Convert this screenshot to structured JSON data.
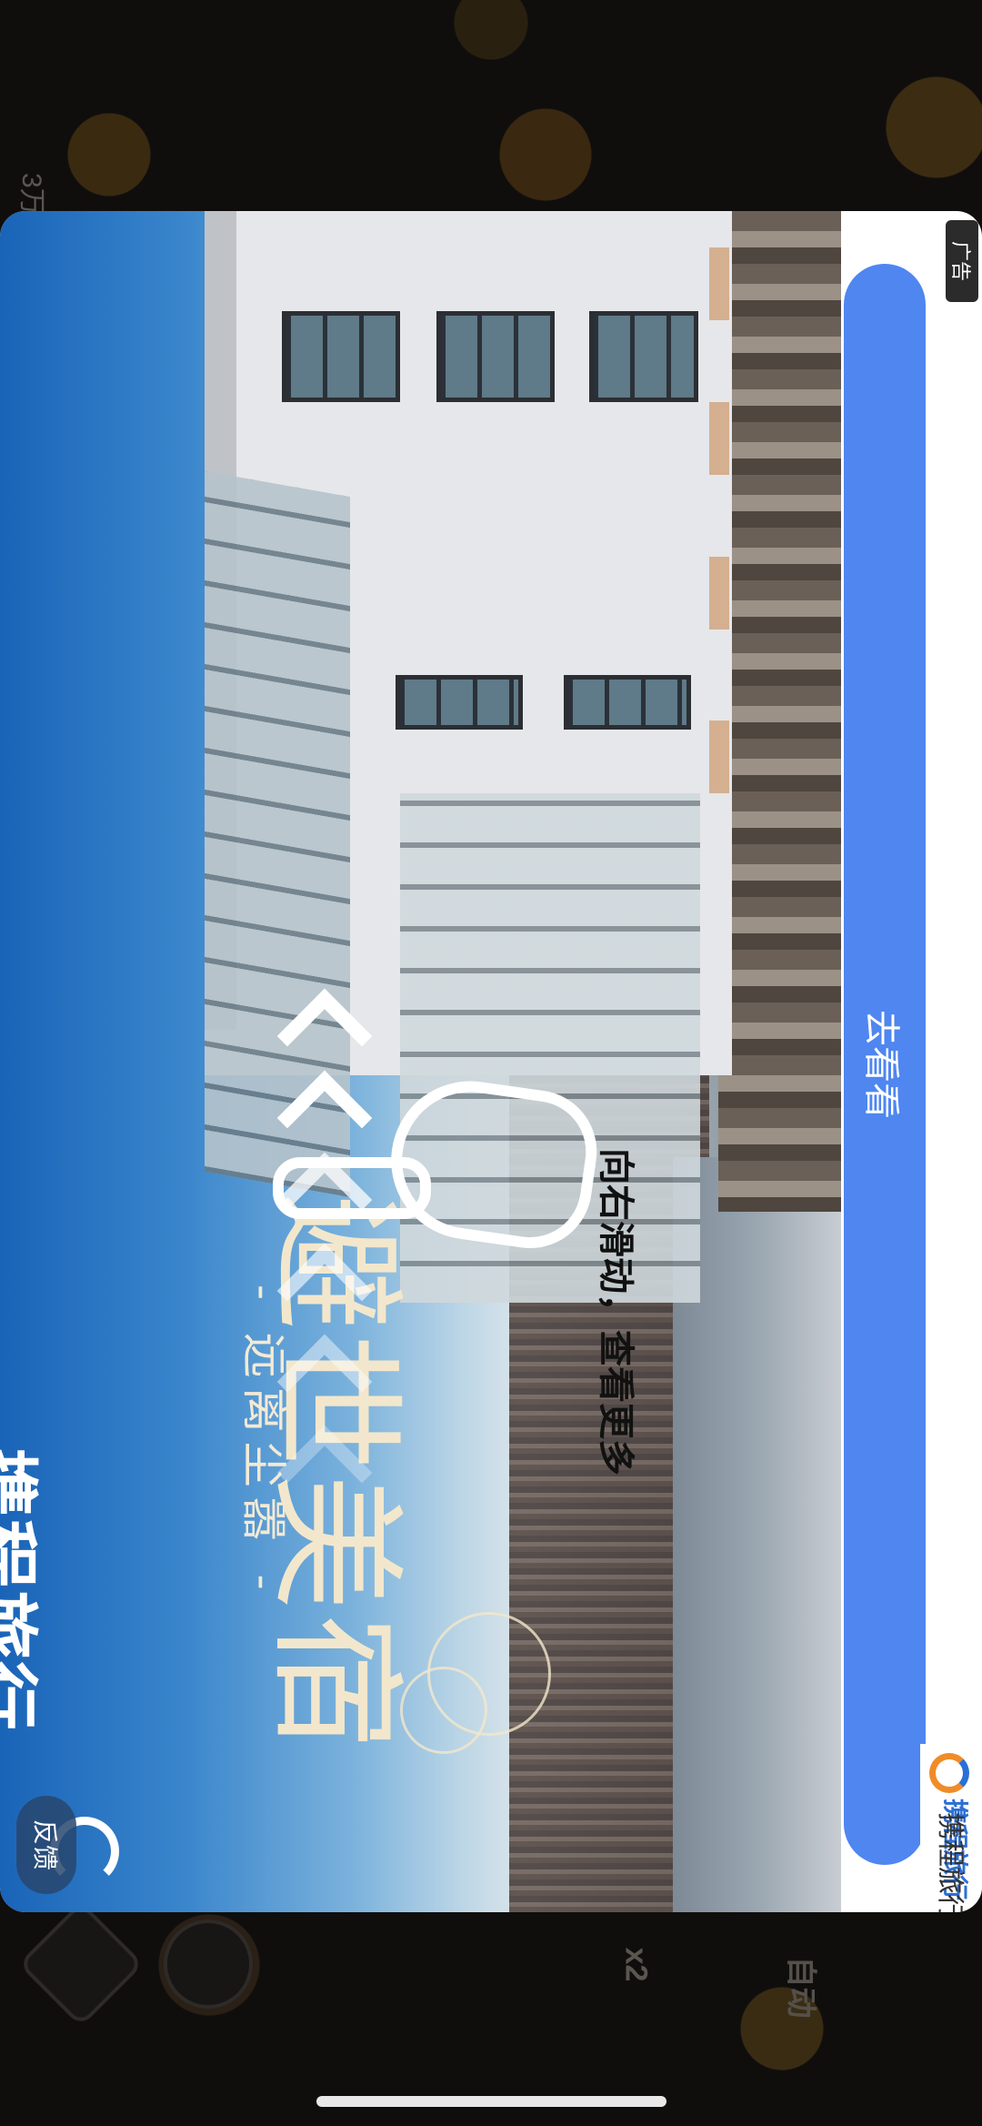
{
  "background": {
    "counter_text": "3万",
    "auto_label": "自动",
    "speed_label": "x2"
  },
  "ad": {
    "brand_logo_text": "携程旅行",
    "subtitle": "- 远离尘嚣 -",
    "headline": "避世美宿",
    "swipe_hint": "向右滑动，查看更多",
    "cta_label": "去看看",
    "ad_tag": "广告",
    "feedback_label": "反馈",
    "advertiser_name": "携程旅行",
    "advertiser_logo_text": "携程旅行",
    "cta_color": "#4f86f0"
  }
}
